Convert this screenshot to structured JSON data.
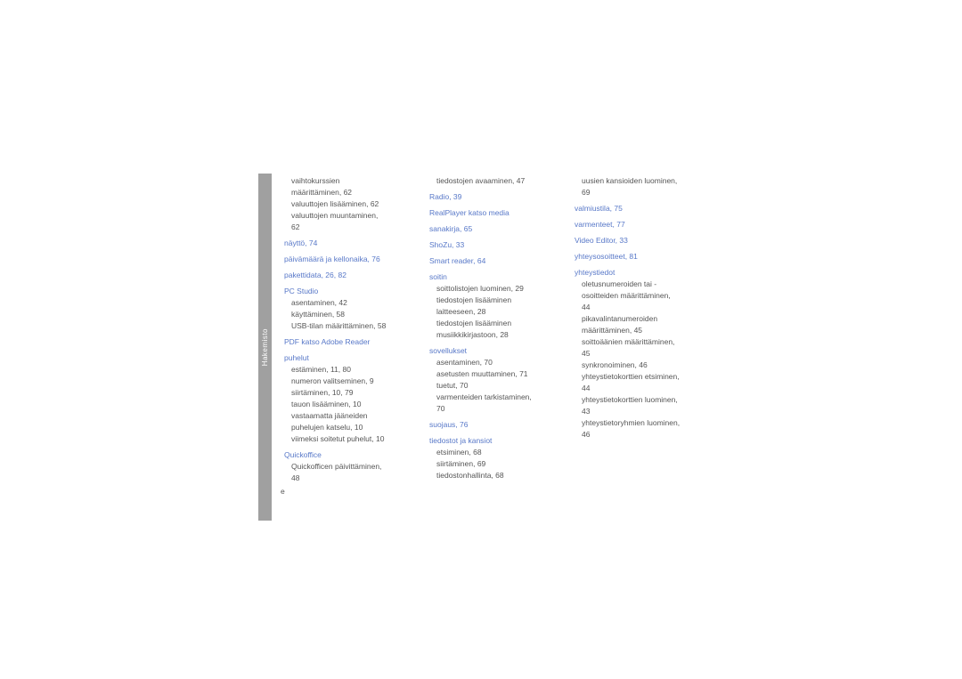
{
  "tabLabel": "Hakemisto",
  "pageLetter": "e",
  "columns": [
    [
      {
        "type": "sub",
        "text": "vaihtokurssien"
      },
      {
        "type": "sub",
        "text": "määrittäminen,  62"
      },
      {
        "type": "sub",
        "text": "valuuttojen lisääminen,  62"
      },
      {
        "type": "sub",
        "text": "valuuttojen muuntaminen,"
      },
      {
        "type": "sub",
        "text": "62"
      },
      {
        "type": "heading",
        "text": "näyttö,  74"
      },
      {
        "type": "heading",
        "text": "päivämäärä ja kellonaika,  76"
      },
      {
        "type": "heading",
        "text": "pakettidata,  26,  82"
      },
      {
        "type": "heading",
        "text": "PC Studio"
      },
      {
        "type": "sub",
        "text": "asentaminen,  42"
      },
      {
        "type": "sub",
        "text": "käyttäminen,  58"
      },
      {
        "type": "sub",
        "text": "USB-tilan määrittäminen,  58"
      },
      {
        "type": "heading",
        "text": "PDF katso Adobe Reader"
      },
      {
        "type": "heading",
        "text": "puhelut"
      },
      {
        "type": "sub",
        "text": "estäminen,  11,  80"
      },
      {
        "type": "sub",
        "text": "numeron valitseminen,  9"
      },
      {
        "type": "sub",
        "text": "siirtäminen,  10,  79"
      },
      {
        "type": "sub",
        "text": "tauon lisääminen,  10"
      },
      {
        "type": "sub",
        "text": "vastaamatta jääneiden"
      },
      {
        "type": "sub",
        "text": "puhelujen katselu,  10"
      },
      {
        "type": "sub",
        "text": "viimeksi soitetut puhelut,  10"
      },
      {
        "type": "heading",
        "text": "Quickoffice"
      },
      {
        "type": "sub",
        "text": "Quickofficen päivittäminen,"
      },
      {
        "type": "sub",
        "text": "48"
      }
    ],
    [
      {
        "type": "sub",
        "text": "tiedostojen avaaminen,  47"
      },
      {
        "type": "heading",
        "text": "Radio,  39"
      },
      {
        "type": "heading",
        "text": "RealPlayer katso media"
      },
      {
        "type": "heading",
        "text": "sanakirja,  65"
      },
      {
        "type": "heading",
        "text": "ShoZu,  33"
      },
      {
        "type": "heading",
        "text": "Smart reader,  64"
      },
      {
        "type": "heading",
        "text": "soitin"
      },
      {
        "type": "sub",
        "text": "soittolistojen luominen,  29"
      },
      {
        "type": "sub",
        "text": "tiedostojen lisääminen"
      },
      {
        "type": "sub",
        "text": "laitteeseen,  28"
      },
      {
        "type": "sub",
        "text": "tiedostojen lisääminen"
      },
      {
        "type": "sub",
        "text": "musiikkikirjastoon,  28"
      },
      {
        "type": "heading",
        "text": "sovellukset"
      },
      {
        "type": "sub",
        "text": "asentaminen,  70"
      },
      {
        "type": "sub",
        "text": "asetusten muuttaminen,  71"
      },
      {
        "type": "sub",
        "text": "tuetut,  70"
      },
      {
        "type": "sub",
        "text": "varmenteiden tarkistaminen,"
      },
      {
        "type": "sub",
        "text": "70"
      },
      {
        "type": "heading",
        "text": "suojaus,  76"
      },
      {
        "type": "heading",
        "text": "tiedostot ja kansiot"
      },
      {
        "type": "sub",
        "text": "etsiminen,  68"
      },
      {
        "type": "sub",
        "text": "siirtäminen,  69"
      },
      {
        "type": "sub",
        "text": "tiedostonhallinta,  68"
      }
    ],
    [
      {
        "type": "sub",
        "text": "uusien kansioiden luominen,"
      },
      {
        "type": "sub",
        "text": "69"
      },
      {
        "type": "heading",
        "text": "valmiustila,  75"
      },
      {
        "type": "heading",
        "text": "varmenteet,  77"
      },
      {
        "type": "heading",
        "text": "Video Editor,  33"
      },
      {
        "type": "heading",
        "text": "yhteysosoitteet,  81"
      },
      {
        "type": "heading",
        "text": "yhteystiedot"
      },
      {
        "type": "sub",
        "text": "oletusnumeroiden tai -"
      },
      {
        "type": "sub",
        "text": "osoitteiden määrittäminen,"
      },
      {
        "type": "sub",
        "text": "44"
      },
      {
        "type": "sub",
        "text": "pikavalintanumeroiden"
      },
      {
        "type": "sub",
        "text": "määrittäminen,  45"
      },
      {
        "type": "sub",
        "text": "soittoäänien määrittäminen,"
      },
      {
        "type": "sub",
        "text": "45"
      },
      {
        "type": "sub",
        "text": "synkronoiminen,  46"
      },
      {
        "type": "sub",
        "text": "yhteystietokorttien etsiminen,"
      },
      {
        "type": "sub",
        "text": "44"
      },
      {
        "type": "sub",
        "text": "yhteystietokorttien luominen,"
      },
      {
        "type": "sub",
        "text": "43"
      },
      {
        "type": "sub",
        "text": "yhteystietoryhmien luominen,"
      },
      {
        "type": "sub",
        "text": "46"
      }
    ]
  ]
}
